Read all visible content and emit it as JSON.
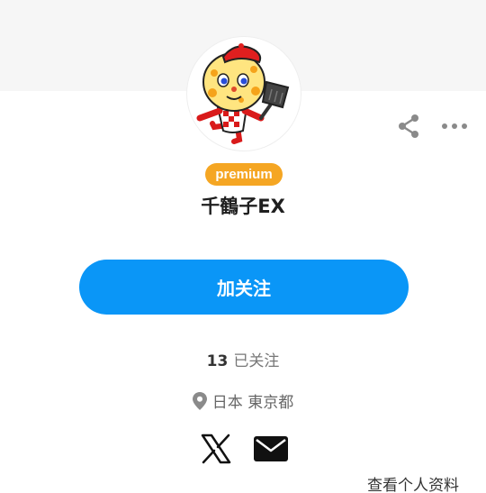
{
  "profile": {
    "badge": "premium",
    "display_name": "千鶴子EX",
    "follow_label": "加关注",
    "following_count": "13",
    "following_label": "已关注",
    "location": "日本 東京都",
    "view_profile_label": "查看个人资料"
  },
  "icons": {
    "share": "share-icon",
    "more": "more-icon",
    "pin": "location-pin-icon",
    "x": "x-logo-icon",
    "mail": "mail-icon"
  },
  "colors": {
    "accent": "#0a96f7",
    "badge": "#f5a623"
  }
}
